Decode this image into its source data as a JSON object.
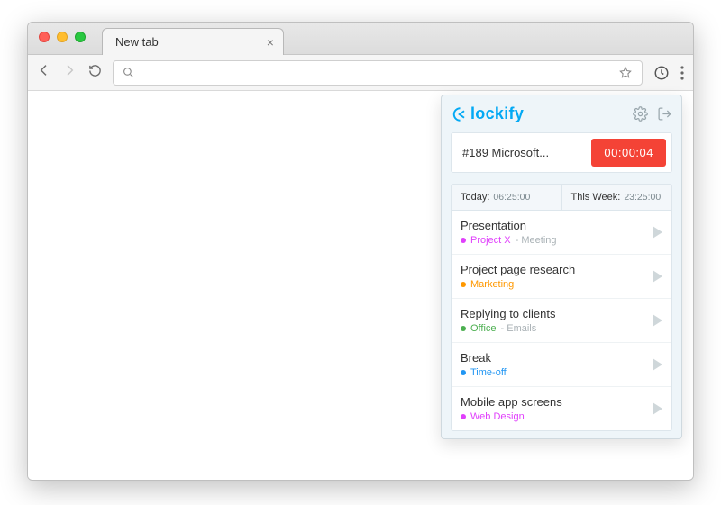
{
  "browser": {
    "tab_title": "New tab",
    "tab_close": "×"
  },
  "popup": {
    "brand": "lockify",
    "current_entry": "#189 Microsoft...",
    "timer": "00:00:04",
    "summary": {
      "today_label": "Today:",
      "today_value": "06:25:00",
      "week_label": "This Week:",
      "week_value": "23:25:00"
    },
    "entries": [
      {
        "title": "Presentation",
        "project": "Project X",
        "task": "Meeting",
        "color": "#e040fb"
      },
      {
        "title": "Project page research",
        "project": "Marketing",
        "task": "",
        "color": "#ff9800"
      },
      {
        "title": "Replying to clients",
        "project": "Office",
        "task": "Emails",
        "color": "#4caf50"
      },
      {
        "title": "Break",
        "project": "Time-off",
        "task": "",
        "color": "#2196f3"
      },
      {
        "title": "Mobile app screens",
        "project": "Web Design",
        "task": "",
        "color": "#e040fb"
      }
    ]
  }
}
